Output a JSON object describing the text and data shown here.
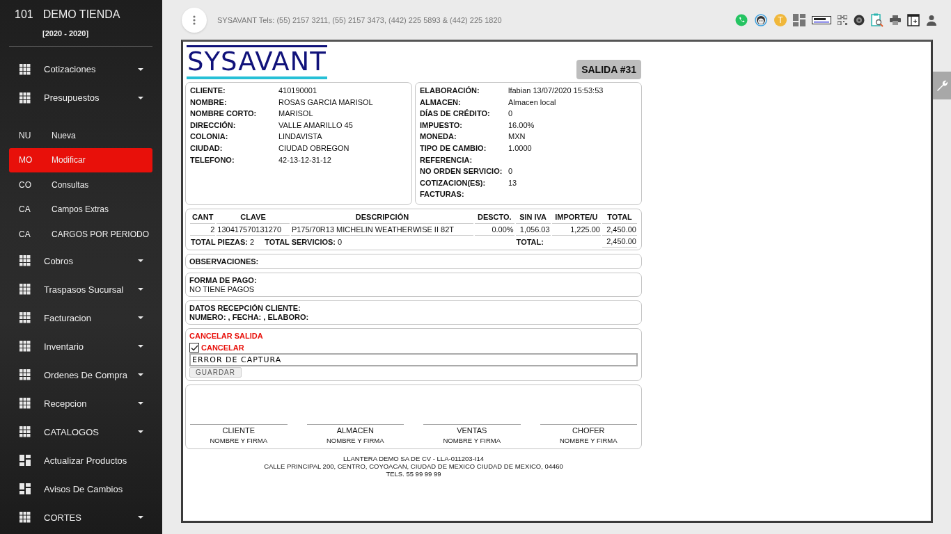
{
  "sidebar": {
    "store_number": "101",
    "store_name": "DEMO TIENDA",
    "period": "[2020 - 2020]",
    "items": [
      {
        "kind": "group",
        "label": "Cotizaciones",
        "selected": false
      },
      {
        "kind": "group",
        "label": "Presupuestos",
        "selected": false
      },
      {
        "kind": "sub",
        "abbr": "NU",
        "label": "Nueva",
        "selected": false
      },
      {
        "kind": "sub",
        "abbr": "MO",
        "label": "Modificar",
        "selected": true
      },
      {
        "kind": "sub",
        "abbr": "CO",
        "label": "Consultas",
        "selected": false
      },
      {
        "kind": "sub",
        "abbr": "CA",
        "label": "Campos Extras",
        "selected": false
      },
      {
        "kind": "sub",
        "abbr": "CA",
        "label": "CARGOS POR PERIODO",
        "selected": false
      },
      {
        "kind": "group",
        "label": "Cobros",
        "selected": false
      },
      {
        "kind": "group",
        "label": "Traspasos Sucursal",
        "selected": false
      },
      {
        "kind": "group",
        "label": "Facturacion",
        "selected": false
      },
      {
        "kind": "group",
        "label": "Inventario",
        "selected": false
      },
      {
        "kind": "group",
        "label": "Ordenes De Compra",
        "selected": false
      },
      {
        "kind": "group",
        "label": "Recepcion",
        "selected": false
      },
      {
        "kind": "group",
        "label": "CATALOGOS",
        "selected": false
      },
      {
        "kind": "link",
        "label": "Actualizar Productos",
        "selected": false
      },
      {
        "kind": "link",
        "label": "Avisos De Cambios",
        "selected": false
      },
      {
        "kind": "group",
        "label": "CORTES",
        "selected": false
      }
    ]
  },
  "topbar": {
    "contact": "SYSAVANT Tels: (55) 2157 3211, (55) 2157 3473, (442) 225 5893 & (442) 225 1820",
    "avatar_letter": "T"
  },
  "document": {
    "logo": "SYSAVANT",
    "badge": "SALIDA #31",
    "client_fields": [
      {
        "label": "CLIENTE:",
        "value": "410190001"
      },
      {
        "label": "NOMBRE:",
        "value": "ROSAS GARCIA MARISOL"
      },
      {
        "label": "NOMBRE CORTO:",
        "value": "MARISOL"
      },
      {
        "label": "DIRECCIÓN:",
        "value": "VALLE AMARILLO 45"
      },
      {
        "label": "COLONIA:",
        "value": "LINDAVISTA"
      },
      {
        "label": "CIUDAD:",
        "value": "CIUDAD OBREGON"
      },
      {
        "label": "TELEFONO:",
        "value": "42-13-12-31-12"
      }
    ],
    "order_fields": [
      {
        "label": "ELABORACIÓN:",
        "value": "lfabian 13/07/2020 15:53:53"
      },
      {
        "label": "ALMACEN:",
        "value": "Almacen local"
      },
      {
        "label": "DÍAS DE CRÉDITO:",
        "value": "0"
      },
      {
        "label": "IMPUESTO:",
        "value": "16.00%"
      },
      {
        "label": "MONEDA:",
        "value": "MXN"
      },
      {
        "label": "TIPO DE CAMBIO:",
        "value": "1.0000"
      },
      {
        "label": "REFERENCIA:"
      },
      {
        "label": "NO ORDEN SERVICIO:",
        "value": "0"
      },
      {
        "label": "COTIZACION(ES):",
        "value": "13"
      },
      {
        "label": "FACTURAS:"
      }
    ],
    "table": {
      "columns": [
        "CANT",
        "CLAVE",
        "DESCRIPCIÓN",
        "DESCTO.",
        "SIN IVA",
        "IMPORTE/U",
        "TOTAL"
      ],
      "rows": [
        [
          "2",
          "130417570131270",
          "P175/70R13 MICHELIN WEATHERWISE II 82T",
          "0.00%",
          "1,056.03",
          "1,225.00",
          "2,450.00"
        ]
      ],
      "total_pieces_label": "TOTAL PIEZAS:",
      "total_pieces": "2",
      "total_services_label": "TOTAL SERVICIOS:",
      "total_services": "0",
      "total_label": "TOTAL:",
      "total": "2,450.00"
    },
    "observations_label": "OBSERVACIONES:",
    "payment_label": "FORMA DE PAGO:",
    "payment_value": "NO TIENE PAGOS",
    "reception_title": "DATOS RECEPCIÓN CLIENTE:",
    "reception_line": "NUMERO: , FECHA: , ELABORO:",
    "cancel": {
      "title": "CANCELAR SALIDA",
      "checkbox_label": "CANCELAR",
      "checked": true,
      "reason": "ERROR DE CAPTURA",
      "button": "GUARDAR"
    },
    "signatures": [
      {
        "role": "CLIENTE",
        "caption": "NOMBRE Y FIRMA"
      },
      {
        "role": "ALMACEN",
        "caption": "NOMBRE Y FIRMA"
      },
      {
        "role": "VENTAS",
        "caption": "NOMBRE Y FIRMA"
      },
      {
        "role": "CHOFER",
        "caption": "NOMBRE Y FIRMA"
      }
    ],
    "footer": [
      "LLANTERA DEMO SA DE CV - LLA-011203-I14",
      "CALLE PRINCIPAL 200, CENTRO, COYOACAN, CIUDAD DE MEXICO CIUDAD DE MEXICO, 04460",
      "TELS. 55 99 99 99"
    ]
  }
}
